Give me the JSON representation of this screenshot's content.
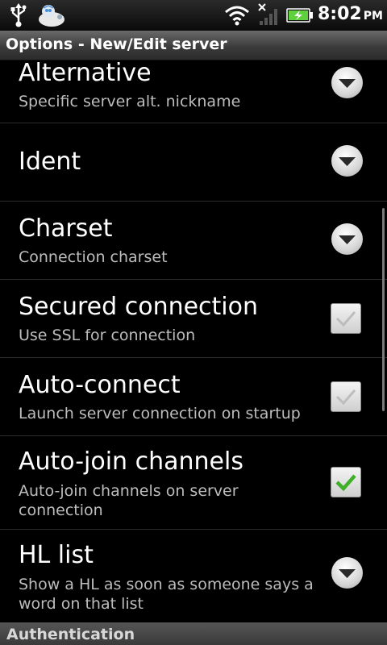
{
  "status_bar": {
    "time": "8:02",
    "ampm": "PM",
    "icons": [
      "usb-icon",
      "app-notification-icon",
      "wifi-icon",
      "no-signal-icon",
      "battery-charging-icon"
    ]
  },
  "title_bar": {
    "title": "Options - New/Edit server"
  },
  "preferences": [
    {
      "title": "Alternative",
      "summary": "Specific server alt. nickname",
      "widget": "dropdown"
    },
    {
      "title": "Ident",
      "summary": "",
      "widget": "dropdown"
    },
    {
      "title": "Charset",
      "summary": "Connection charset",
      "widget": "dropdown"
    },
    {
      "title": "Secured connection",
      "summary": "Use SSL for connection",
      "widget": "checkbox",
      "checked": false
    },
    {
      "title": "Auto-connect",
      "summary": "Launch server connection on startup",
      "widget": "checkbox",
      "checked": false
    },
    {
      "title": "Auto-join channels",
      "summary": "Auto-join channels on server connection",
      "widget": "checkbox",
      "checked": true
    },
    {
      "title": "HL list",
      "summary": "Show a HL as soon as someone says a word on that list",
      "widget": "dropdown"
    }
  ],
  "section_header": {
    "label": "Authentication"
  },
  "colors": {
    "check_green": "#3fae29",
    "check_grey": "#b8b8b8",
    "background": "#000000",
    "summary_text": "#bdbdbd"
  }
}
